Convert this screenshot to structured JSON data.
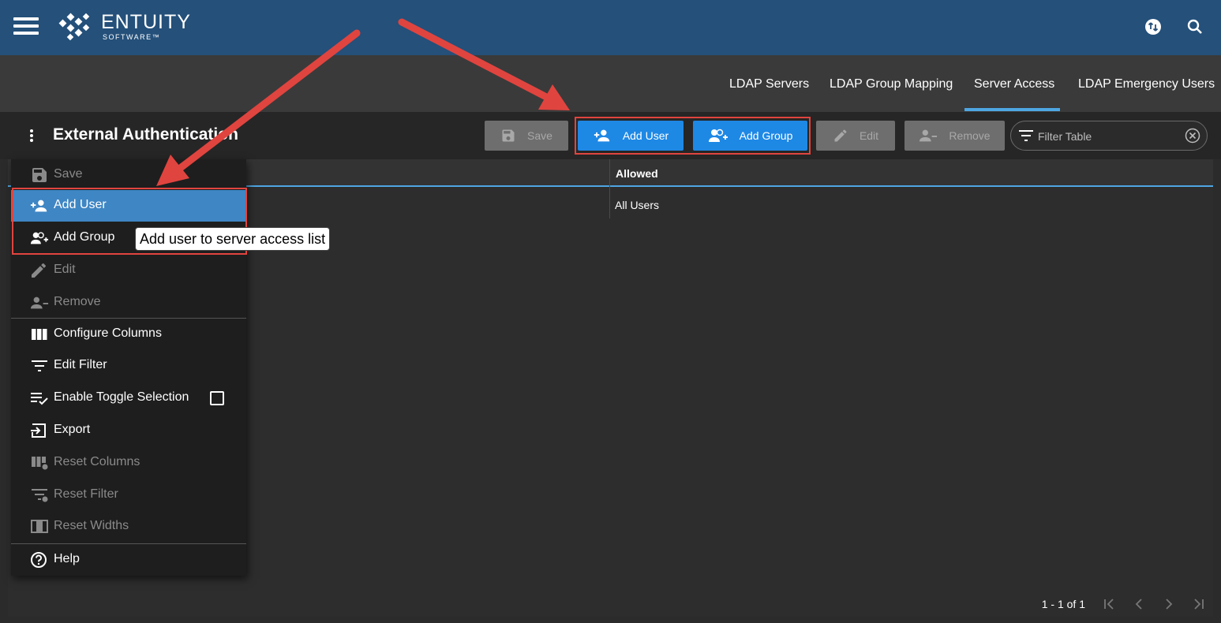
{
  "header": {
    "logo_text": "ENTUITY",
    "logo_sub": "SOFTWARE™",
    "icons": [
      "menu-icon",
      "sync-icon",
      "search-icon"
    ]
  },
  "tabs": [
    {
      "label": "LDAP Servers",
      "active": false
    },
    {
      "label": "LDAP Group Mapping",
      "active": false
    },
    {
      "label": "Server Access",
      "active": true
    },
    {
      "label": "LDAP Emergency Users",
      "active": false
    }
  ],
  "toolbar": {
    "title": "External Authentication",
    "save_label": "Save",
    "add_user_label": "Add User",
    "add_group_label": "Add Group",
    "edit_label": "Edit",
    "remove_label": "Remove",
    "filter_placeholder": "Filter Table"
  },
  "table": {
    "columns": [
      "Allowed"
    ],
    "rows": [
      [
        "All Users"
      ]
    ],
    "pager_text": "1 - 1 of 1"
  },
  "menu": {
    "items": [
      {
        "label": "Save",
        "icon": "save-icon",
        "enabled": false
      },
      {
        "label": "Add User",
        "icon": "add-user-icon",
        "enabled": true,
        "highlighted": true
      },
      {
        "label": "Add Group",
        "icon": "add-group-icon",
        "enabled": true
      },
      {
        "label": "Edit",
        "icon": "pencil-icon",
        "enabled": false
      },
      {
        "label": "Remove",
        "icon": "remove-user-icon",
        "enabled": false
      },
      {
        "label": "Configure Columns",
        "icon": "columns-icon",
        "enabled": true
      },
      {
        "label": "Edit Filter",
        "icon": "filter-icon",
        "enabled": true
      },
      {
        "label": "Enable Toggle Selection",
        "icon": "toggle-selection-icon",
        "enabled": true,
        "checked": false
      },
      {
        "label": "Export",
        "icon": "export-icon",
        "enabled": true
      },
      {
        "label": "Reset Columns",
        "icon": "reset-columns-icon",
        "enabled": false
      },
      {
        "label": "Reset Filter",
        "icon": "reset-filter-icon",
        "enabled": false
      },
      {
        "label": "Reset Widths",
        "icon": "reset-widths-icon",
        "enabled": false
      },
      {
        "label": "Help",
        "icon": "help-icon",
        "enabled": true
      }
    ]
  },
  "tooltip": "Add user to server access list",
  "colors": {
    "header_bg": "#24507a",
    "primary_button": "#1e88e5",
    "highlight": "#3f86c4",
    "annotation_red": "#e0443f",
    "tab_underline": "#4ea6e2"
  }
}
